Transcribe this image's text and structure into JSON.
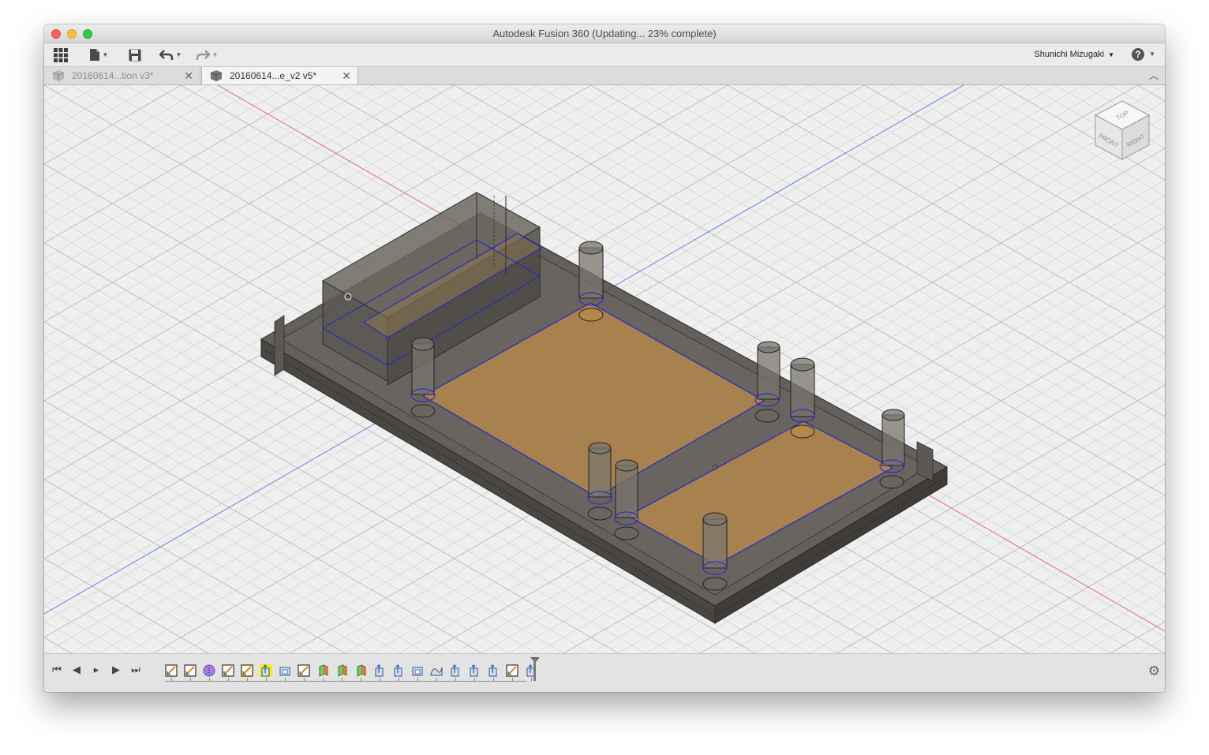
{
  "window": {
    "title": "Autodesk Fusion 360  (Updating... 23% complete)"
  },
  "toolbar": {
    "icons": [
      "apps-grid-icon",
      "file-icon",
      "save-icon",
      "undo-icon",
      "redo-icon"
    ],
    "user_name": "Shunichi Mizugaki",
    "help_label": "?"
  },
  "tabs": [
    {
      "label": "20160614...tion v3*",
      "active": false
    },
    {
      "label": "20160614...e_v2 v5*",
      "active": true
    }
  ],
  "viewcube": {
    "top": "TOP",
    "front": "FRONT",
    "right": "RIGHT"
  },
  "timeline": {
    "controls": [
      "go-to-start",
      "step-back",
      "play",
      "step-forward",
      "go-to-end"
    ],
    "features": [
      {
        "type": "sketch"
      },
      {
        "type": "sketch"
      },
      {
        "type": "body"
      },
      {
        "type": "sketch"
      },
      {
        "type": "sketch",
        "highlight": true
      },
      {
        "type": "extrude",
        "highlight": true
      },
      {
        "type": "shell"
      },
      {
        "type": "sketch"
      },
      {
        "type": "revolve"
      },
      {
        "type": "revolve"
      },
      {
        "type": "revolve"
      },
      {
        "type": "extrude"
      },
      {
        "type": "extrude"
      },
      {
        "type": "shell"
      },
      {
        "type": "surface"
      },
      {
        "type": "extrude"
      },
      {
        "type": "extrude"
      },
      {
        "type": "extrude"
      },
      {
        "type": "sketch"
      },
      {
        "type": "extrude"
      }
    ]
  },
  "colors": {
    "axis_x": "#e06060",
    "axis_z": "#5577dd",
    "sketch_line": "#2222cc",
    "floor_fill": "#b88a4a",
    "body_fill": "#5a5650",
    "highlight": "#f4f000"
  }
}
